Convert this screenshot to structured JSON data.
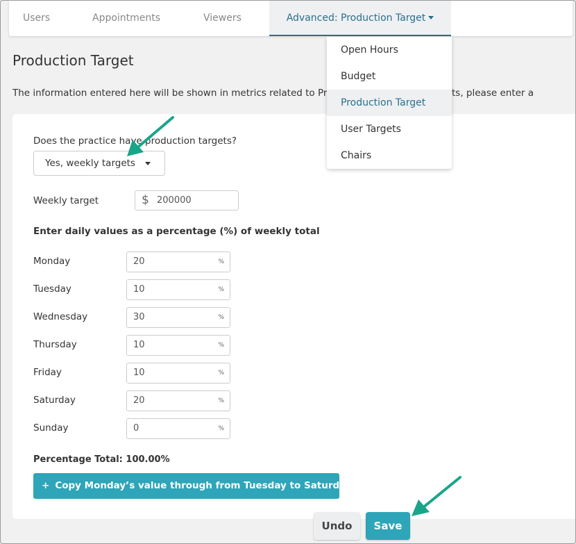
{
  "tabs": [
    {
      "label": "Users"
    },
    {
      "label": "Appointments"
    },
    {
      "label": "Viewers"
    },
    {
      "label": "Advanced: Production Target"
    }
  ],
  "menu": {
    "items": [
      {
        "label": "Open Hours"
      },
      {
        "label": "Budget"
      },
      {
        "label": "Production Target"
      },
      {
        "label": "User Targets"
      },
      {
        "label": "Chairs"
      }
    ],
    "selected": "Production Target"
  },
  "page": {
    "title": "Production Target",
    "description": "The information entered here will be shown in metrics related to Production. For weekly targets, please enter a"
  },
  "form": {
    "question": "Does the practice have production targets?",
    "select_value": "Yes, weekly targets",
    "weekly_label": "Weekly target",
    "currency_symbol": "$",
    "weekly_value": "200000",
    "daily_heading": "Enter daily values as a percentage (%) of weekly total",
    "pct_symbol": "%",
    "days": [
      {
        "label": "Monday",
        "value": "20"
      },
      {
        "label": "Tuesday",
        "value": "10"
      },
      {
        "label": "Wednesday",
        "value": "30"
      },
      {
        "label": "Thursday",
        "value": "10"
      },
      {
        "label": "Friday",
        "value": "10"
      },
      {
        "label": "Saturday",
        "value": "20"
      },
      {
        "label": "Sunday",
        "value": "0"
      }
    ],
    "percentage_total": "Percentage Total: 100.00%",
    "copy_button_icon": "+",
    "copy_button": "Copy Monday’s value through from Tuesday to Saturday"
  },
  "actions": {
    "undo": "Undo",
    "save": "Save"
  },
  "colors": {
    "accent": "#2ea5b8",
    "active_tab_text": "#2a6f8f",
    "annotation_arrow": "#1aa58a"
  }
}
